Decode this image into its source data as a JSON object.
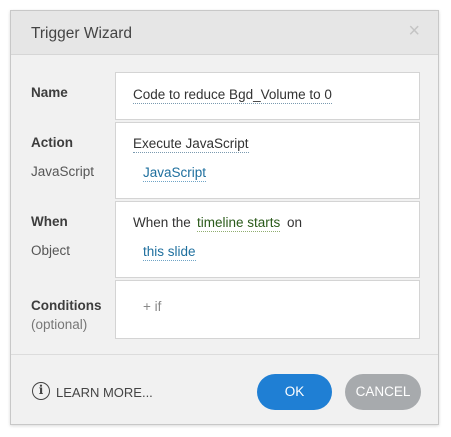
{
  "dialog": {
    "title": "Trigger Wizard",
    "close_glyph": "×"
  },
  "name": {
    "label": "Name",
    "value": "Code to reduce Bgd_Volume to 0"
  },
  "action": {
    "label": "Action",
    "value": "Execute JavaScript",
    "sub_label": "JavaScript",
    "sub_value": "JavaScript"
  },
  "when": {
    "label": "When",
    "prefix": "When the",
    "event": "timeline starts",
    "suffix": "on",
    "sub_label": "Object",
    "object": "this slide"
  },
  "conditions": {
    "label": "Conditions",
    "hint": "(optional)",
    "add_if": "+ if"
  },
  "footer": {
    "info_glyph": "i",
    "learn_more": "LEARN MORE...",
    "ok": "OK",
    "cancel": "CANCEL"
  },
  "colors": {
    "ok_button": "#1f7fd4",
    "cancel_button": "#a7aaad",
    "link": "#1e6f9e"
  },
  "icons": [
    "close-icon",
    "info-icon"
  ]
}
